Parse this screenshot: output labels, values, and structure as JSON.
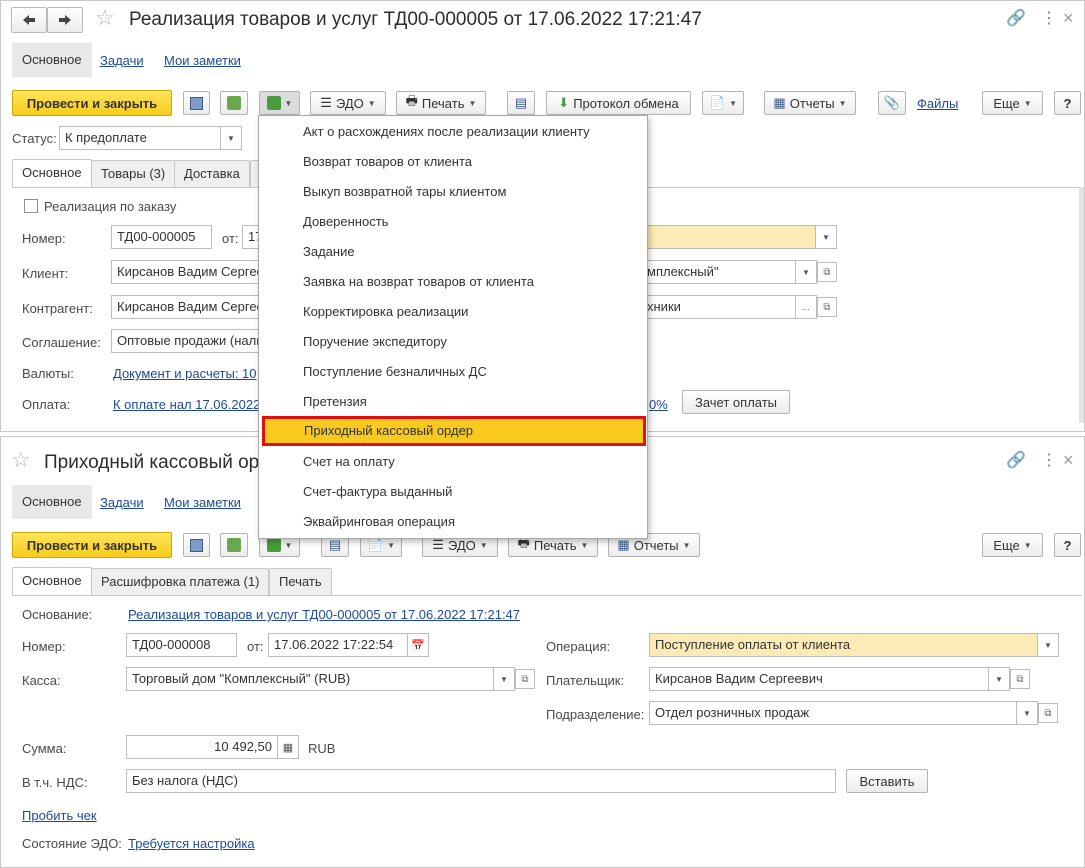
{
  "top_form": {
    "title": "Реализация товаров и услуг ТД00-000005 от 17.06.2022 17:21:47",
    "nav_tabs": {
      "main": "Основное",
      "tasks": "Задачи",
      "notes": "Мои заметки"
    },
    "toolbar": {
      "post_close": "Провести и закрыть",
      "edo": "ЭДО",
      "print": "Печать",
      "protocol": "Протокол обмена",
      "reports": "Отчеты",
      "files": "Файлы",
      "more": "Еще",
      "help": "?"
    },
    "status_label": "Статус:",
    "status_value": "К предоплате",
    "tabs": {
      "main": "Основное",
      "goods": "Товары (3)",
      "delivery": "Доставка"
    },
    "by_order": "Реализация по заказу",
    "number_label": "Номер:",
    "number_value": "ТД00-000005",
    "from_label": "от:",
    "from_value": "17",
    "client_label": "Клиент:",
    "client_value": "Кирсанов Вадим Сергеев",
    "client_right": "мплексный\"",
    "contractor_label": "Контрагент:",
    "contractor_value": "Кирсанов Вадим Сергеев",
    "contractor_right": "хники",
    "agreement_label": "Соглашение:",
    "agreement_value": "Оптовые продажи (нали",
    "currency_label": "Валюты:",
    "currency_link": "Документ и расчеты: 10",
    "payment_label": "Оплата:",
    "payment_link": "К оплате нал 17.06.2022",
    "payment_pct": "0%",
    "offset_btn": "Зачет оплаты"
  },
  "menu": {
    "items": [
      "Акт о расхождениях после реализации клиенту",
      "Возврат товаров от клиента",
      "Выкуп возвратной тары клиентом",
      "Доверенность",
      "Задание",
      "Заявка на возврат товаров от клиента",
      "Корректировка реализации",
      "Поручение экспедитору",
      "Поступление безналичных ДС",
      "Претензия",
      "Приходный кассовый ордер",
      "Счет на оплату",
      "Счет-фактура выданный",
      "Эквайринговая операция"
    ],
    "selected_index": 10
  },
  "bottom_form": {
    "title": "Приходный кассовый ор",
    "nav_tabs": {
      "main": "Основное",
      "tasks": "Задачи",
      "notes": "Мои заметки"
    },
    "toolbar": {
      "post_close": "Провести и закрыть",
      "edo": "ЭДО",
      "print": "Печать",
      "reports": "Отчеты",
      "more": "Еще",
      "help": "?"
    },
    "tabs": {
      "main": "Основное",
      "decoding": "Расшифровка платежа (1)",
      "print": "Печать"
    },
    "basis_label": "Основание:",
    "basis_link": "Реализация товаров и услуг ТД00-000005 от 17.06.2022 17:21:47",
    "number_label": "Номер:",
    "number_value": "ТД00-000008",
    "from_label": "от:",
    "from_value": "17.06.2022 17:22:54",
    "operation_label": "Операция:",
    "operation_value": "Поступление оплаты от клиента",
    "cash_label": "Касса:",
    "cash_value": "Торговый дом \"Комплексный\" (RUB)",
    "payer_label": "Плательщик:",
    "payer_value": "Кирсанов Вадим Сергеевич",
    "division_label": "Подразделение:",
    "division_value": "Отдел розничных продаж",
    "sum_label": "Сумма:",
    "sum_value": "10 492,50",
    "sum_currency": "RUB",
    "vat_label": "В т.ч. НДС:",
    "vat_value": "Без налога (НДС)",
    "insert_btn": "Вставить",
    "check_link": "Пробить чек",
    "edo_state_label": "Состояние ЭДО:",
    "edo_state_link": "Требуется настройка"
  }
}
